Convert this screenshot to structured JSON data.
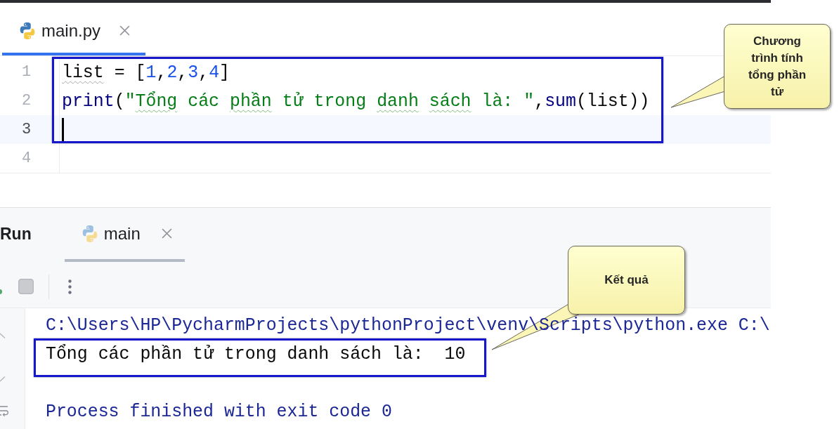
{
  "editor": {
    "tabs": [
      {
        "label": "main.py",
        "selected": true
      }
    ],
    "lines": [
      {
        "number": "1",
        "current": false,
        "tokens": [
          {
            "text": "list",
            "kind": "plain",
            "squiggle": true
          },
          {
            "text": " = [",
            "kind": "plain",
            "squiggle": false
          },
          {
            "text": "1",
            "kind": "number",
            "squiggle": false
          },
          {
            "text": ",",
            "kind": "plain",
            "squiggle": false
          },
          {
            "text": "2",
            "kind": "number",
            "squiggle": false
          },
          {
            "text": ",",
            "kind": "plain",
            "squiggle": false
          },
          {
            "text": "3",
            "kind": "number",
            "squiggle": false
          },
          {
            "text": ",",
            "kind": "plain",
            "squiggle": false
          },
          {
            "text": "4",
            "kind": "number",
            "squiggle": false
          },
          {
            "text": "]",
            "kind": "plain",
            "squiggle": false
          }
        ]
      },
      {
        "number": "2",
        "current": false,
        "tokens": [
          {
            "text": "print",
            "kind": "builtin",
            "squiggle": false
          },
          {
            "text": "(",
            "kind": "plain",
            "squiggle": false
          },
          {
            "text": "\"",
            "kind": "string",
            "squiggle": false
          },
          {
            "text": "Tổng",
            "kind": "string",
            "squiggle": true
          },
          {
            "text": " các ",
            "kind": "string",
            "squiggle": false
          },
          {
            "text": "phần",
            "kind": "string",
            "squiggle": true
          },
          {
            "text": " tử trong ",
            "kind": "string",
            "squiggle": false
          },
          {
            "text": "danh sách",
            "kind": "string",
            "squiggle": true
          },
          {
            "text": " là: \"",
            "kind": "string",
            "squiggle": false
          },
          {
            "text": ",",
            "kind": "plain",
            "squiggle": false
          },
          {
            "text": "sum",
            "kind": "builtin",
            "squiggle": false
          },
          {
            "text": "(list))",
            "kind": "plain",
            "squiggle": false
          }
        ]
      },
      {
        "number": "3",
        "current": true
      },
      {
        "number": "4",
        "current": false
      }
    ]
  },
  "callouts": [
    {
      "kind": "code",
      "text": "Chương trình tính tổng phần tử"
    },
    {
      "kind": "output",
      "text": "Kết quả"
    }
  ],
  "run_panel": {
    "title": "Run",
    "tabs": [
      {
        "label": "main",
        "selected": true
      }
    ],
    "toolbar": [
      {
        "kind": "rerun"
      },
      {
        "kind": "stop",
        "disabled": true
      },
      {
        "kind": "separator"
      },
      {
        "kind": "more"
      }
    ],
    "side_tools": [
      {
        "kind": "scroll_up"
      },
      {
        "kind": "scroll_down"
      },
      {
        "kind": "soft_wrap"
      }
    ],
    "console": [
      {
        "kind": "command",
        "text": "C:\\Users\\HP\\PycharmProjects\\pythonProject\\venv\\Scripts\\python.exe C:\\"
      },
      {
        "kind": "output",
        "text": "Tổng các phần tử trong danh sách là:  10"
      },
      {
        "kind": "exit",
        "text": "Process finished with exit code 0"
      }
    ]
  }
}
